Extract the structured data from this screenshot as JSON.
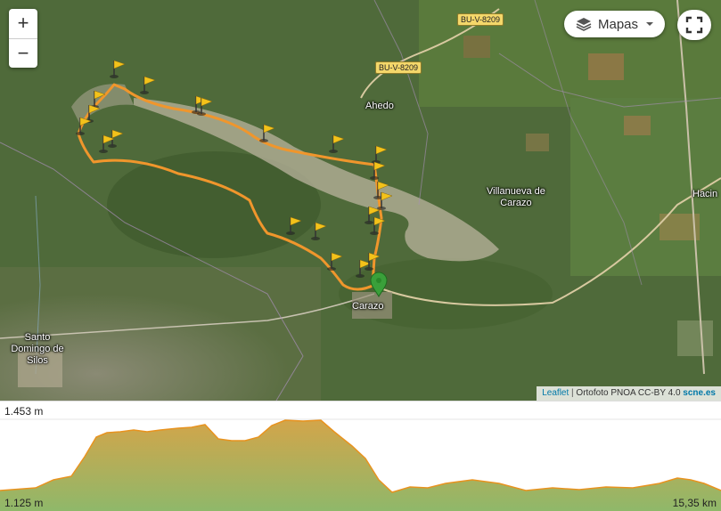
{
  "map": {
    "places": {
      "ahedo": "Ahedo",
      "villanueva_line1": "Villanueva de",
      "villanueva_line2": "Carazo",
      "carazo": "Carazo",
      "santo_line1": "Santo",
      "santo_line2": "Domingo de",
      "santo_line3": "Silos",
      "hacin": "Hacin"
    },
    "roads": {
      "shield_top": "BU-V-8209",
      "shield_mid": "BU-V-8209"
    },
    "colors": {
      "track": "#f0962c",
      "marker": "#3aa03a",
      "flag": "#f3c21a"
    }
  },
  "controls": {
    "zoom_in": "+",
    "zoom_out": "−",
    "layers_label": "Mapas",
    "layers_icon": "layers-icon",
    "fullscreen_icon": "fullscreen-icon"
  },
  "attribution": {
    "leaflet": "Leaflet",
    "separator": " | ",
    "text": "Ortofoto PNOA CC-BY 4.0 ",
    "scne": "scne.es"
  },
  "profile": {
    "max_elevation": "1.453 m",
    "min_elevation": "1.125 m",
    "distance": "15,35 km",
    "colors": {
      "line": "#e8931f",
      "fill_top": "#d3a54a",
      "fill_bottom": "#8fb86a"
    }
  }
}
